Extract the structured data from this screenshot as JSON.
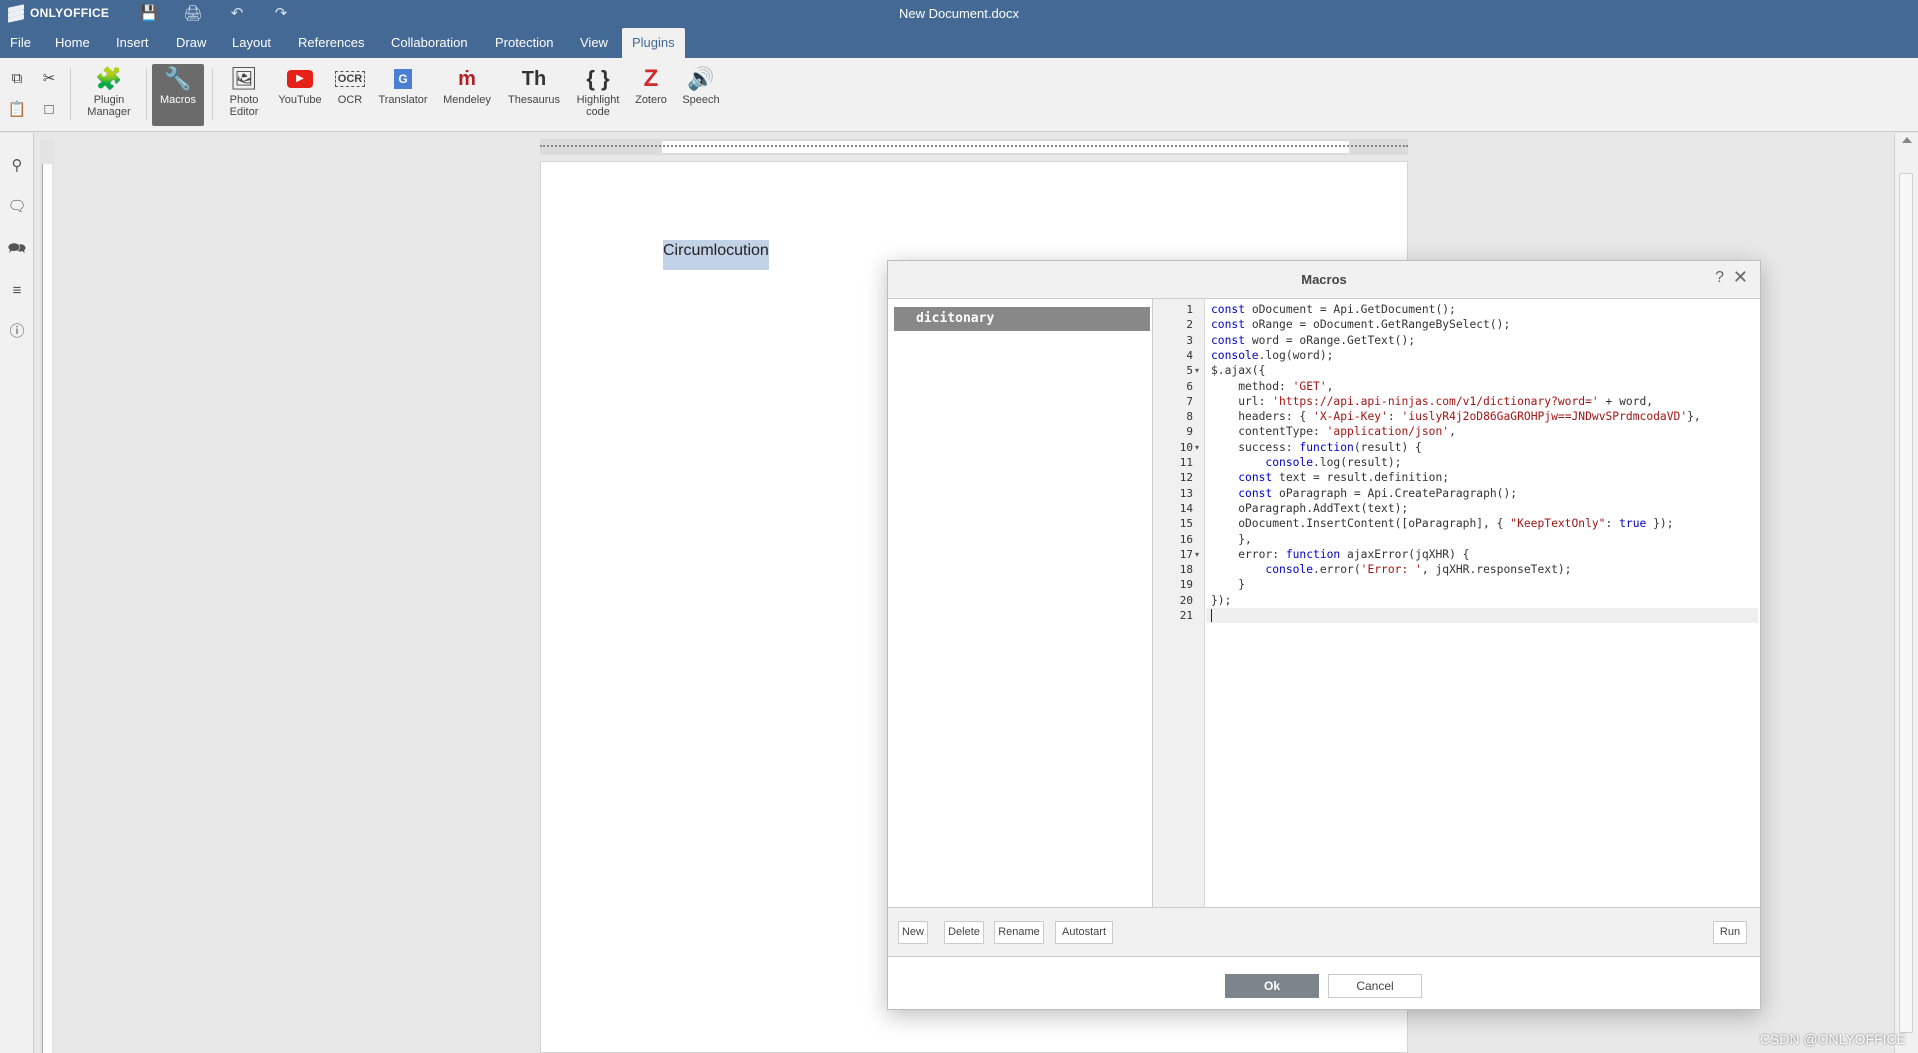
{
  "app": {
    "logo_text": "ONLYOFFICE",
    "document_title": "New Document.docx",
    "accent_color": "#446995"
  },
  "menu": {
    "tabs": [
      "File",
      "Home",
      "Insert",
      "Draw",
      "Layout",
      "References",
      "Collaboration",
      "Protection",
      "View",
      "Plugins"
    ],
    "active_tab": "Plugins"
  },
  "toolbar": {
    "plugin_manager": "Plugin Manager",
    "macros": "Macros",
    "photo_editor": "Photo Editor",
    "youtube": "YouTube",
    "ocr": "OCR",
    "translator": "Translator",
    "mendeley": "Mendeley",
    "thesaurus": "Thesaurus",
    "highlight_code": "Highlight code",
    "zotero": "Zotero",
    "speech": "Speech"
  },
  "document": {
    "selected_text": "Circumlocution"
  },
  "macros_dialog": {
    "title": "Macros",
    "macro_list": [
      "dicitonary"
    ],
    "selected_macro": "dicitonary",
    "code_lines": [
      "const oDocument = Api.GetDocument();",
      "const oRange = oDocument.GetRangeBySelect();",
      "const word = oRange.GetText();",
      "console.log(word);",
      "$.ajax({",
      "    method: 'GET',",
      "    url: 'https://api.api-ninjas.com/v1/dictionary?word=' + word,",
      "    headers: { 'X-Api-Key': 'iuslyR4j2oD86GaGROHPjw==JNDwvSPrdmcodaVD'},",
      "    contentType: 'application/json',",
      "    success: function(result) {",
      "        console.log(result);",
      "    const text = result.definition;",
      "    const oParagraph = Api.CreateParagraph();",
      "    oParagraph.AddText(text);",
      "    oDocument.InsertContent([oParagraph], { \"KeepTextOnly\": true });",
      "    },",
      "    error: function ajaxError(jqXHR) {",
      "        console.error('Error: ', jqXHR.responseText);",
      "    }",
      "});",
      ""
    ],
    "buttons": {
      "new": "New",
      "delete": "Delete",
      "rename": "Rename",
      "autostart": "Autostart",
      "run": "Run",
      "ok": "Ok",
      "cancel": "Cancel"
    }
  },
  "watermark": "CSDN @ONLYOFFICE"
}
